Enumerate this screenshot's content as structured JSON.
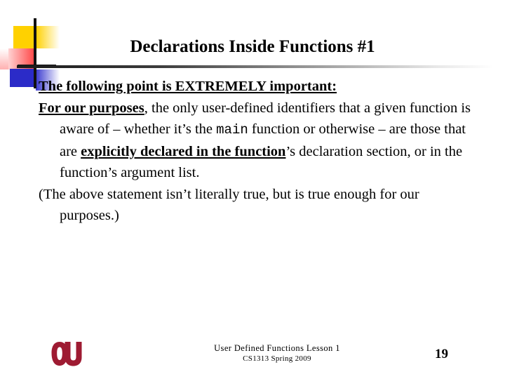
{
  "slide": {
    "title": "Declarations Inside Functions #1",
    "body": {
      "p1": {
        "bold_underline": "The following point is EXTREMELY important:"
      },
      "p2": {
        "lead_bold_underline": "For our purposes",
        "text_a": ", the only user-defined identifiers that a given function is aware of – whether it’s the ",
        "mono": "main",
        "text_b": " function or otherwise – are those that are ",
        "bold_underline": "explicitly declared in the function",
        "text_c": "’s declaration section, or in the function’s argument list."
      },
      "p3": {
        "text": "(The above statement isn’t literally true, but is true enough for our purposes.)"
      }
    },
    "footer": {
      "line1": "User Defined Functions Lesson 1",
      "line2": "CS1313 Spring 2009",
      "page_number": "19",
      "logo_name": "OU"
    },
    "colors": {
      "yellow": "#FFD100",
      "red": "#FF4040",
      "blue": "#2B2BC8",
      "crimson": "#9E1B32",
      "rule": "#1a1a1a",
      "text": "#000000"
    }
  }
}
